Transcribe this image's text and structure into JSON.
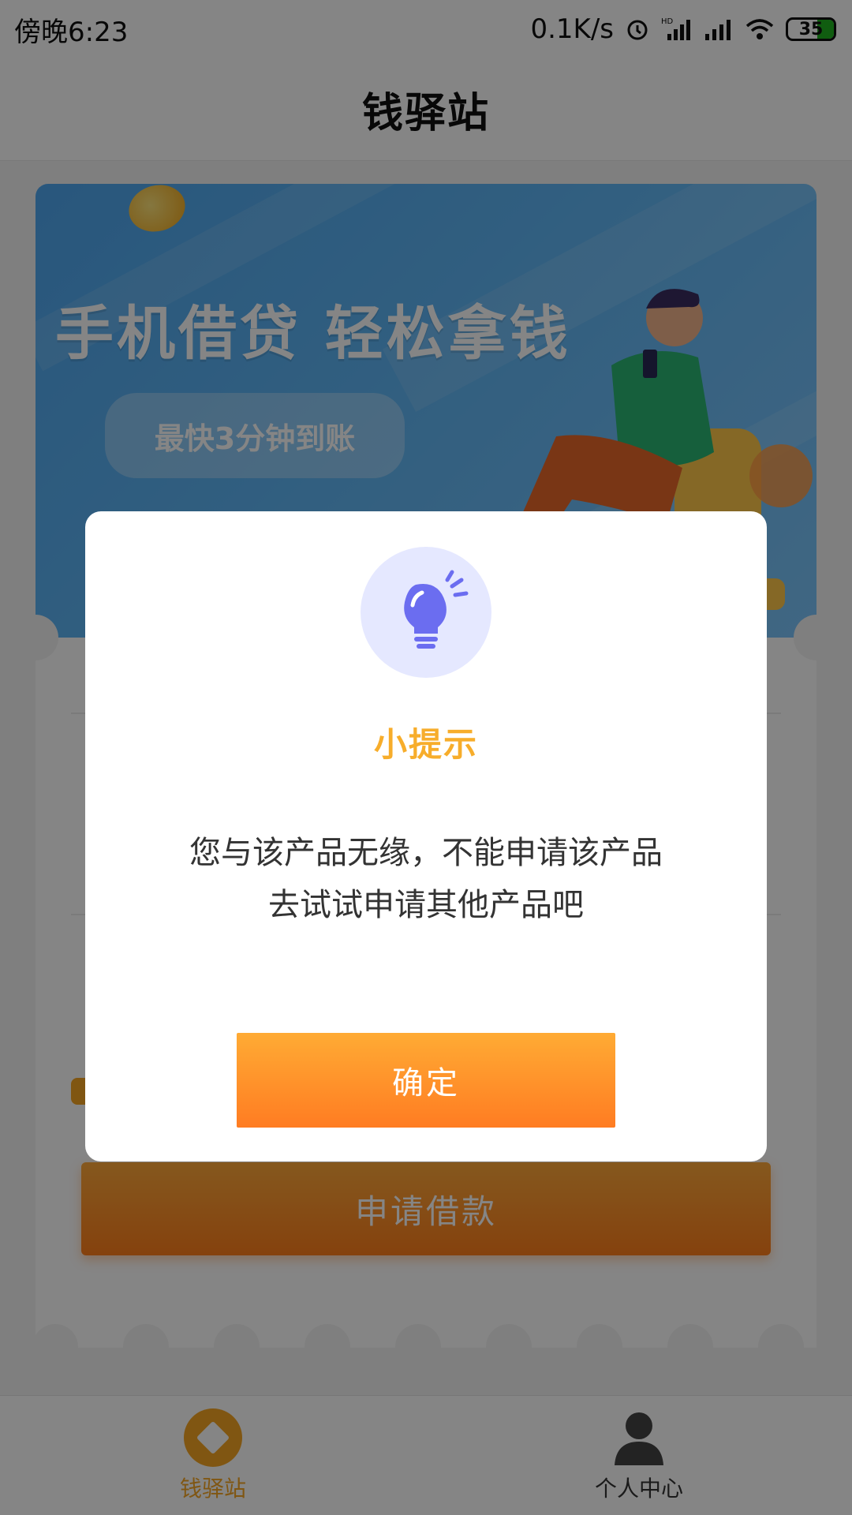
{
  "status_bar": {
    "time": "傍晚6:23",
    "network_speed": "0.1K/s",
    "battery_level": "35",
    "icons": [
      "alarm-icon",
      "hd-signal-icon",
      "signal-icon",
      "wifi-icon",
      "battery-icon"
    ]
  },
  "header": {
    "title": "钱驿站"
  },
  "banner": {
    "headline": "手机借贷 轻松拿钱",
    "tagline": "最快3分钟到账"
  },
  "loan_card": {
    "apply_button": "申请借款"
  },
  "bottom_nav": {
    "items": [
      {
        "label": "钱驿站",
        "icon": "home-diamond-icon",
        "active": true
      },
      {
        "label": "个人中心",
        "icon": "person-icon",
        "active": false
      }
    ]
  },
  "dialog": {
    "icon": "lightbulb-icon",
    "title": "小提示",
    "message_line1": "您与该产品无缘，不能申请该产品",
    "message_line2": "去试试申请其他产品吧",
    "confirm_label": "确定"
  },
  "colors": {
    "accent": "#f6a623",
    "button_gradient_top": "#ffab34",
    "button_gradient_bottom": "#ff7c22",
    "dialog_title": "#f7ad2b",
    "icon_bg": "#e5e8ff",
    "icon_fg": "#6b6df0"
  }
}
